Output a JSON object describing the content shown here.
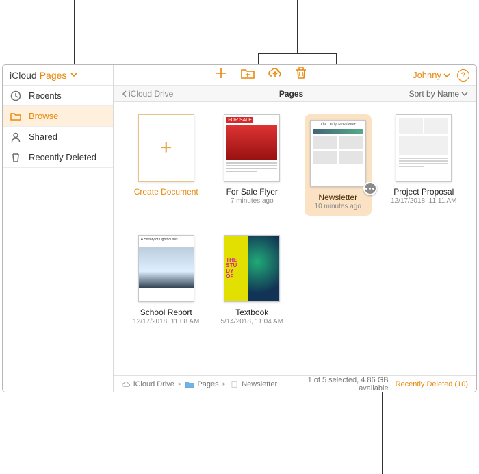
{
  "header": {
    "icloud": "iCloud",
    "app": "Pages",
    "user": "Johnny"
  },
  "sidebar": {
    "items": [
      {
        "label": "Recents"
      },
      {
        "label": "Browse"
      },
      {
        "label": "Shared"
      },
      {
        "label": "Recently Deleted"
      }
    ]
  },
  "subbar": {
    "back": "iCloud Drive",
    "title": "Pages",
    "sort": "Sort by Name"
  },
  "documents": {
    "create": "Create Document",
    "items": [
      {
        "name": "For Sale Flyer",
        "meta": "7 minutes ago"
      },
      {
        "name": "Newsletter",
        "meta": "10 minutes ago"
      },
      {
        "name": "Project Proposal",
        "meta": "12/17/2018, 11:11 AM"
      },
      {
        "name": "School Report",
        "meta": "12/17/2018, 11:08 AM"
      },
      {
        "name": "Textbook",
        "meta": "5/14/2018, 11:04 AM"
      }
    ]
  },
  "thumbtext": {
    "for_sale": "FOR SALE",
    "newsletter_head": "The Daily Newsletter",
    "textbook": "THE\nSTU\nDY\nOF"
  },
  "footer": {
    "crumb": [
      "iCloud Drive",
      "Pages",
      "Newsletter"
    ],
    "status": "1 of 5 selected, 4.86 GB available",
    "recent": "Recently Deleted (10)"
  }
}
